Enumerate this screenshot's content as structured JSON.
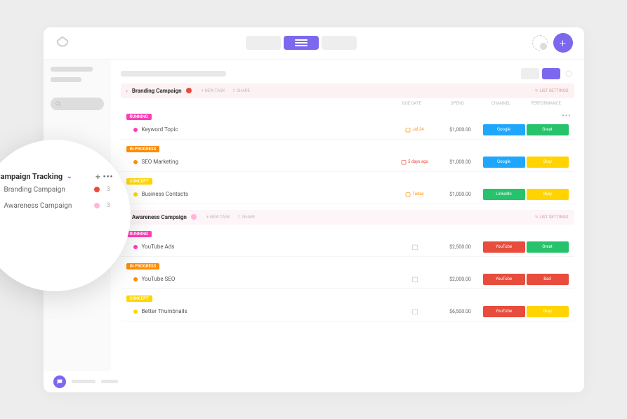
{
  "colors": {
    "purple": "#7b68ee",
    "pink": "#ff3db8",
    "orange": "#ff8c00",
    "yellow": "#ffd400",
    "blue": "#1ea7fd",
    "green": "#2ecc71",
    "red": "#e74c3c",
    "greenChip": "#27c26c",
    "yellowChip": "#ffd400",
    "redBullet": "#e74c3c",
    "pinkLight": "#ffb6d9"
  },
  "header": {
    "plus": "+"
  },
  "zoom": {
    "title": "Campaign Tracking",
    "items": [
      {
        "label": "Branding Campaign",
        "dot": "#e74c3c",
        "count": "3"
      },
      {
        "label": "Awareness Campaign",
        "dot": "#ffb6d9",
        "count": "3"
      }
    ]
  },
  "columns": {
    "date": "DUE DATE",
    "spend": "SPEND",
    "channel": "CHANNEL",
    "perf": "PERFORMANCE"
  },
  "groupMeta": {
    "newTask": "+ NEW TASK",
    "share": "⇪ SHARE",
    "listSettings": "✎ LIST SETTINGS"
  },
  "groups": [
    {
      "title": "Branding Campaign",
      "dot": "#e74c3c",
      "headerBg": "#fdf2f3",
      "sections": [
        {
          "status": "RUNNING",
          "statusColor": "#ff3db8",
          "rows": [
            {
              "bullet": "#ff3db8",
              "name": "Keyword Topic",
              "date": "Jul 24",
              "dateColor": "#ff8c00",
              "spend": "$1,000.00",
              "chips": [
                {
                  "t": "Google",
                  "c": "#1ea7fd"
                },
                {
                  "t": "Great",
                  "c": "#27c26c"
                }
              ],
              "dots": true
            }
          ]
        },
        {
          "status": "IN PROGRESS",
          "statusColor": "#ff8c00",
          "rows": [
            {
              "bullet": "#ff8c00",
              "name": "SEO Marketing",
              "date": "5 days ago",
              "dateColor": "#e74c3c",
              "spend": "$1,000.00",
              "chips": [
                {
                  "t": "Google",
                  "c": "#1ea7fd"
                },
                {
                  "t": "Okay",
                  "c": "#ffd400"
                }
              ]
            }
          ]
        },
        {
          "status": "CONCEPT",
          "statusColor": "#ffd400",
          "rows": [
            {
              "bullet": "#ffd400",
              "name": "Business Contacts",
              "date": "Today",
              "dateColor": "#ff8c00",
              "spend": "$1,000.00",
              "chips": [
                {
                  "t": "LinkedIn",
                  "c": "#27c26c"
                },
                {
                  "t": "Okay",
                  "c": "#ffd400"
                }
              ]
            }
          ]
        }
      ]
    },
    {
      "title": "Awareness Campaign",
      "dot": "#ffb6d9",
      "headerBg": "#fdf5f8",
      "sections": [
        {
          "status": "RUNNING",
          "statusColor": "#ff3db8",
          "rows": [
            {
              "bullet": "#ff3db8",
              "name": "YouTube Ads",
              "date": "",
              "dateColor": "#ccc",
              "spend": "$2,500.00",
              "chips": [
                {
                  "t": "YouTube",
                  "c": "#e74c3c"
                },
                {
                  "t": "Great",
                  "c": "#27c26c"
                }
              ]
            }
          ]
        },
        {
          "status": "IN PROGRESS",
          "statusColor": "#ff8c00",
          "rows": [
            {
              "bullet": "#ff8c00",
              "name": "YouTube SEO",
              "date": "",
              "dateColor": "#ccc",
              "spend": "$2,000.00",
              "chips": [
                {
                  "t": "YouTube",
                  "c": "#e74c3c"
                },
                {
                  "t": "Bad",
                  "c": "#e74c3c"
                }
              ]
            }
          ]
        },
        {
          "status": "CONCEPT",
          "statusColor": "#ffd400",
          "rows": [
            {
              "bullet": "#ffd400",
              "name": "Better Thumbnails",
              "date": "",
              "dateColor": "#ccc",
              "spend": "$6,500.00",
              "chips": [
                {
                  "t": "YouTube",
                  "c": "#e74c3c"
                },
                {
                  "t": "Okay",
                  "c": "#ffd400"
                }
              ]
            }
          ]
        }
      ]
    }
  ]
}
